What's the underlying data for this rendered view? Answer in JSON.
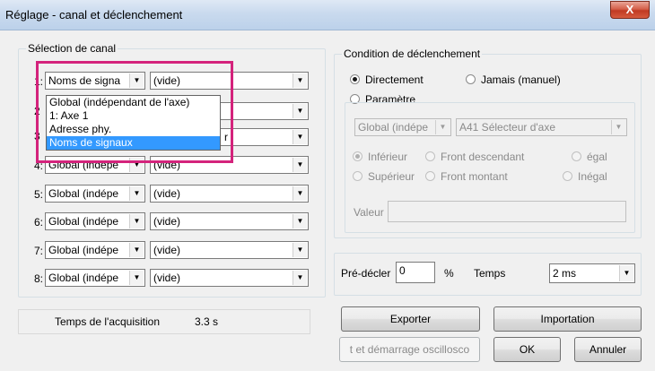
{
  "window": {
    "title": "Réglage - canal et déclenchement",
    "close_label": "X"
  },
  "channel_group": {
    "label": "Sélection de canal",
    "rows": [
      {
        "num": "1:",
        "signal": "Noms de signa",
        "value": "(vide)"
      },
      {
        "num": "2",
        "signal": "",
        "value": ""
      },
      {
        "num": "3",
        "signal": "",
        "value": ""
      },
      {
        "num": "4:",
        "signal": "Global (indépe",
        "value": "(vide)"
      },
      {
        "num": "5:",
        "signal": "Global (indépe",
        "value": "(vide)"
      },
      {
        "num": "6:",
        "signal": "Global (indépe",
        "value": "(vide)"
      },
      {
        "num": "7:",
        "signal": "Global (indépe",
        "value": "(vide)"
      },
      {
        "num": "8:",
        "signal": "Global (indépe",
        "value": "(vide)"
      }
    ],
    "row3_partial": "r",
    "dropdown_items": [
      "Global (indépendant de l'axe)",
      "1: Axe 1",
      "Adresse phy.",
      "Noms de signaux"
    ],
    "dropdown_selected_index": 3,
    "highlight_color": "#d4237c"
  },
  "trigger_group": {
    "label": "Condition de déclenchement",
    "radio_directement": "Directement",
    "radio_jamais": "Jamais (manuel)",
    "radio_parametre": "Paramètre",
    "combo_global": "Global (indépe",
    "combo_axis": "A41 Sélecteur d'axe",
    "radio_inferieur": "Inférieur",
    "radio_front_desc": "Front descendant",
    "radio_egal": "égal",
    "radio_superieur": "Supérieur",
    "radio_front_montant": "Front montant",
    "radio_inegal": "Inégal",
    "valeur_label": "Valeur"
  },
  "pretrigger": {
    "label": "Pré-décler",
    "value": "0",
    "unit": "%",
    "temps_label": "Temps",
    "temps_value": "2 ms"
  },
  "acquisition": {
    "label": "Temps de l'acquisition",
    "value": "3.3 s"
  },
  "buttons": {
    "exporter": "Exporter",
    "importation": "Importation",
    "start_osc": "t et démarrage oscillosco",
    "ok": "OK",
    "annuler": "Annuler"
  },
  "colors": {
    "selection_blue": "#3399ff"
  }
}
